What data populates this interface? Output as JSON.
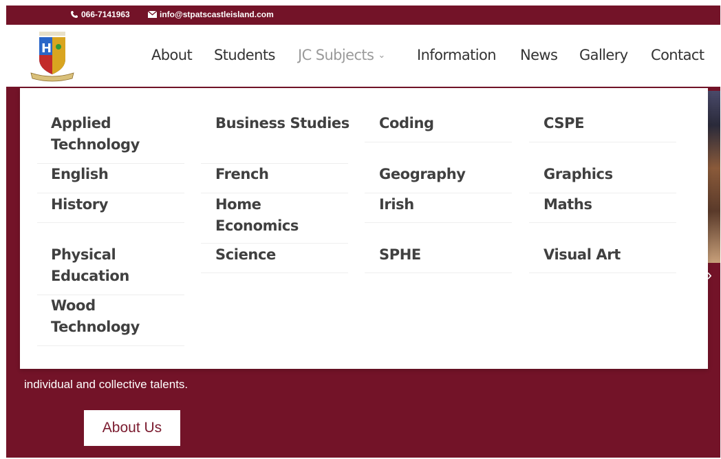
{
  "topbar": {
    "phone": "066-7141963",
    "email": "info@stpatscastleisland.com",
    "phone_icon": "phone-icon",
    "email_icon": "envelope-icon"
  },
  "nav": {
    "items": [
      "About",
      "Students",
      "JC Subjects",
      "Information",
      "News",
      "Gallery",
      "Contact"
    ],
    "active": "JC Subjects"
  },
  "dropdown": {
    "items": [
      "Applied Technology",
      "Business Studies",
      "Coding",
      "CSPE",
      "English",
      "French",
      "Geography",
      "Graphics",
      "History",
      "Home Economics",
      "Irish",
      "Maths",
      "Physical Education",
      "Science",
      "SPHE",
      "Visual Art",
      "Wood Technology"
    ]
  },
  "hero": {
    "text": "individual and collective talents.",
    "button": "About Us"
  },
  "colors": {
    "brand": "#731328",
    "white": "#ffffff",
    "nav_text": "#333333",
    "nav_active": "#9a9a9a"
  }
}
